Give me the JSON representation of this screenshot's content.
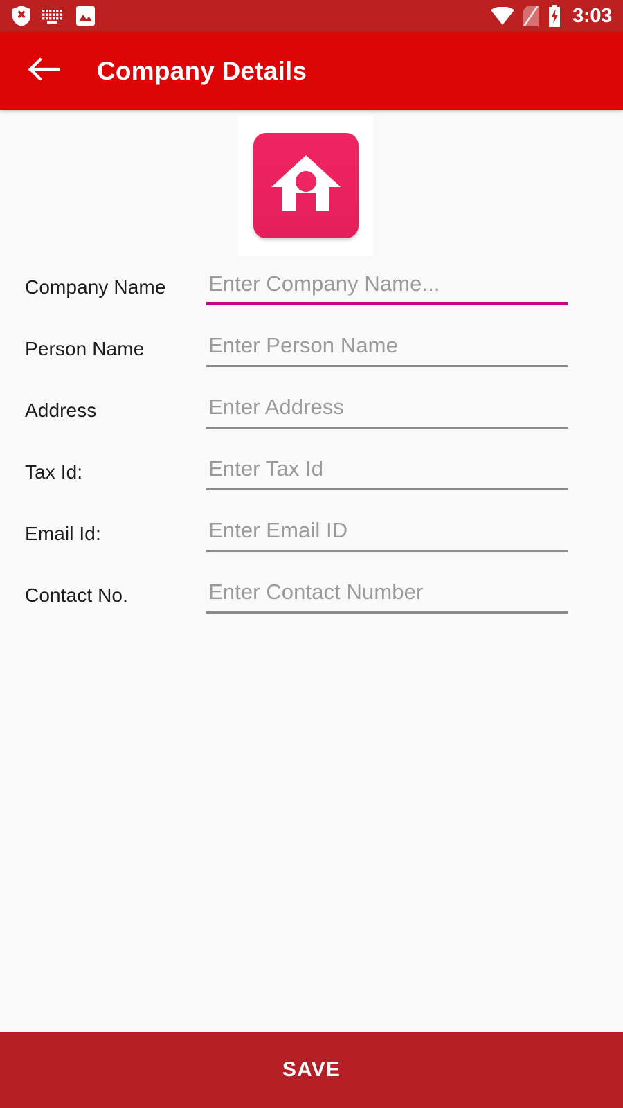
{
  "status_bar": {
    "background_color": "#BD2020",
    "clock": "3:03",
    "left_icons": [
      {
        "name": "shield-x-icon",
        "label": "shield-x"
      },
      {
        "name": "keyboard-icon",
        "label": "keyboard"
      },
      {
        "name": "image-icon",
        "label": "image"
      }
    ],
    "right_icons": [
      {
        "name": "wifi-icon",
        "label": "wifi"
      },
      {
        "name": "no-sim-icon",
        "label": "no-sim"
      },
      {
        "name": "battery-charging-icon",
        "label": "battery-charging"
      }
    ]
  },
  "app_bar": {
    "background_color": "#DD0505",
    "title": "Company Details",
    "back_icon": "arrow-left-icon"
  },
  "logo": {
    "icon": "home-icon",
    "tile_color": "#E61E5C",
    "frame_color": "#FFFFFF"
  },
  "theme": {
    "content_background": "#F9F9F9",
    "accent_focus": "#C9008C",
    "underline_default": "#8A8A8A",
    "label_color": "#1D1D1D",
    "placeholder_color": "#9A9A9A",
    "save_background": "#B42025"
  },
  "form": {
    "fields": [
      {
        "label": "Company Name",
        "placeholder": "Enter Company Name...",
        "value": "",
        "focused": true
      },
      {
        "label": "Person Name",
        "placeholder": "Enter Person Name",
        "value": "",
        "focused": false
      },
      {
        "label": "Address",
        "placeholder": "Enter Address",
        "value": "",
        "focused": false
      },
      {
        "label": "Tax Id:",
        "placeholder": "Enter Tax Id",
        "value": "",
        "focused": false
      },
      {
        "label": "Email Id:",
        "placeholder": "Enter Email ID",
        "value": "",
        "focused": false
      },
      {
        "label": "Contact No.",
        "placeholder": "Enter Contact Number",
        "value": "",
        "focused": false
      }
    ]
  },
  "save_bar": {
    "label": "SAVE"
  }
}
